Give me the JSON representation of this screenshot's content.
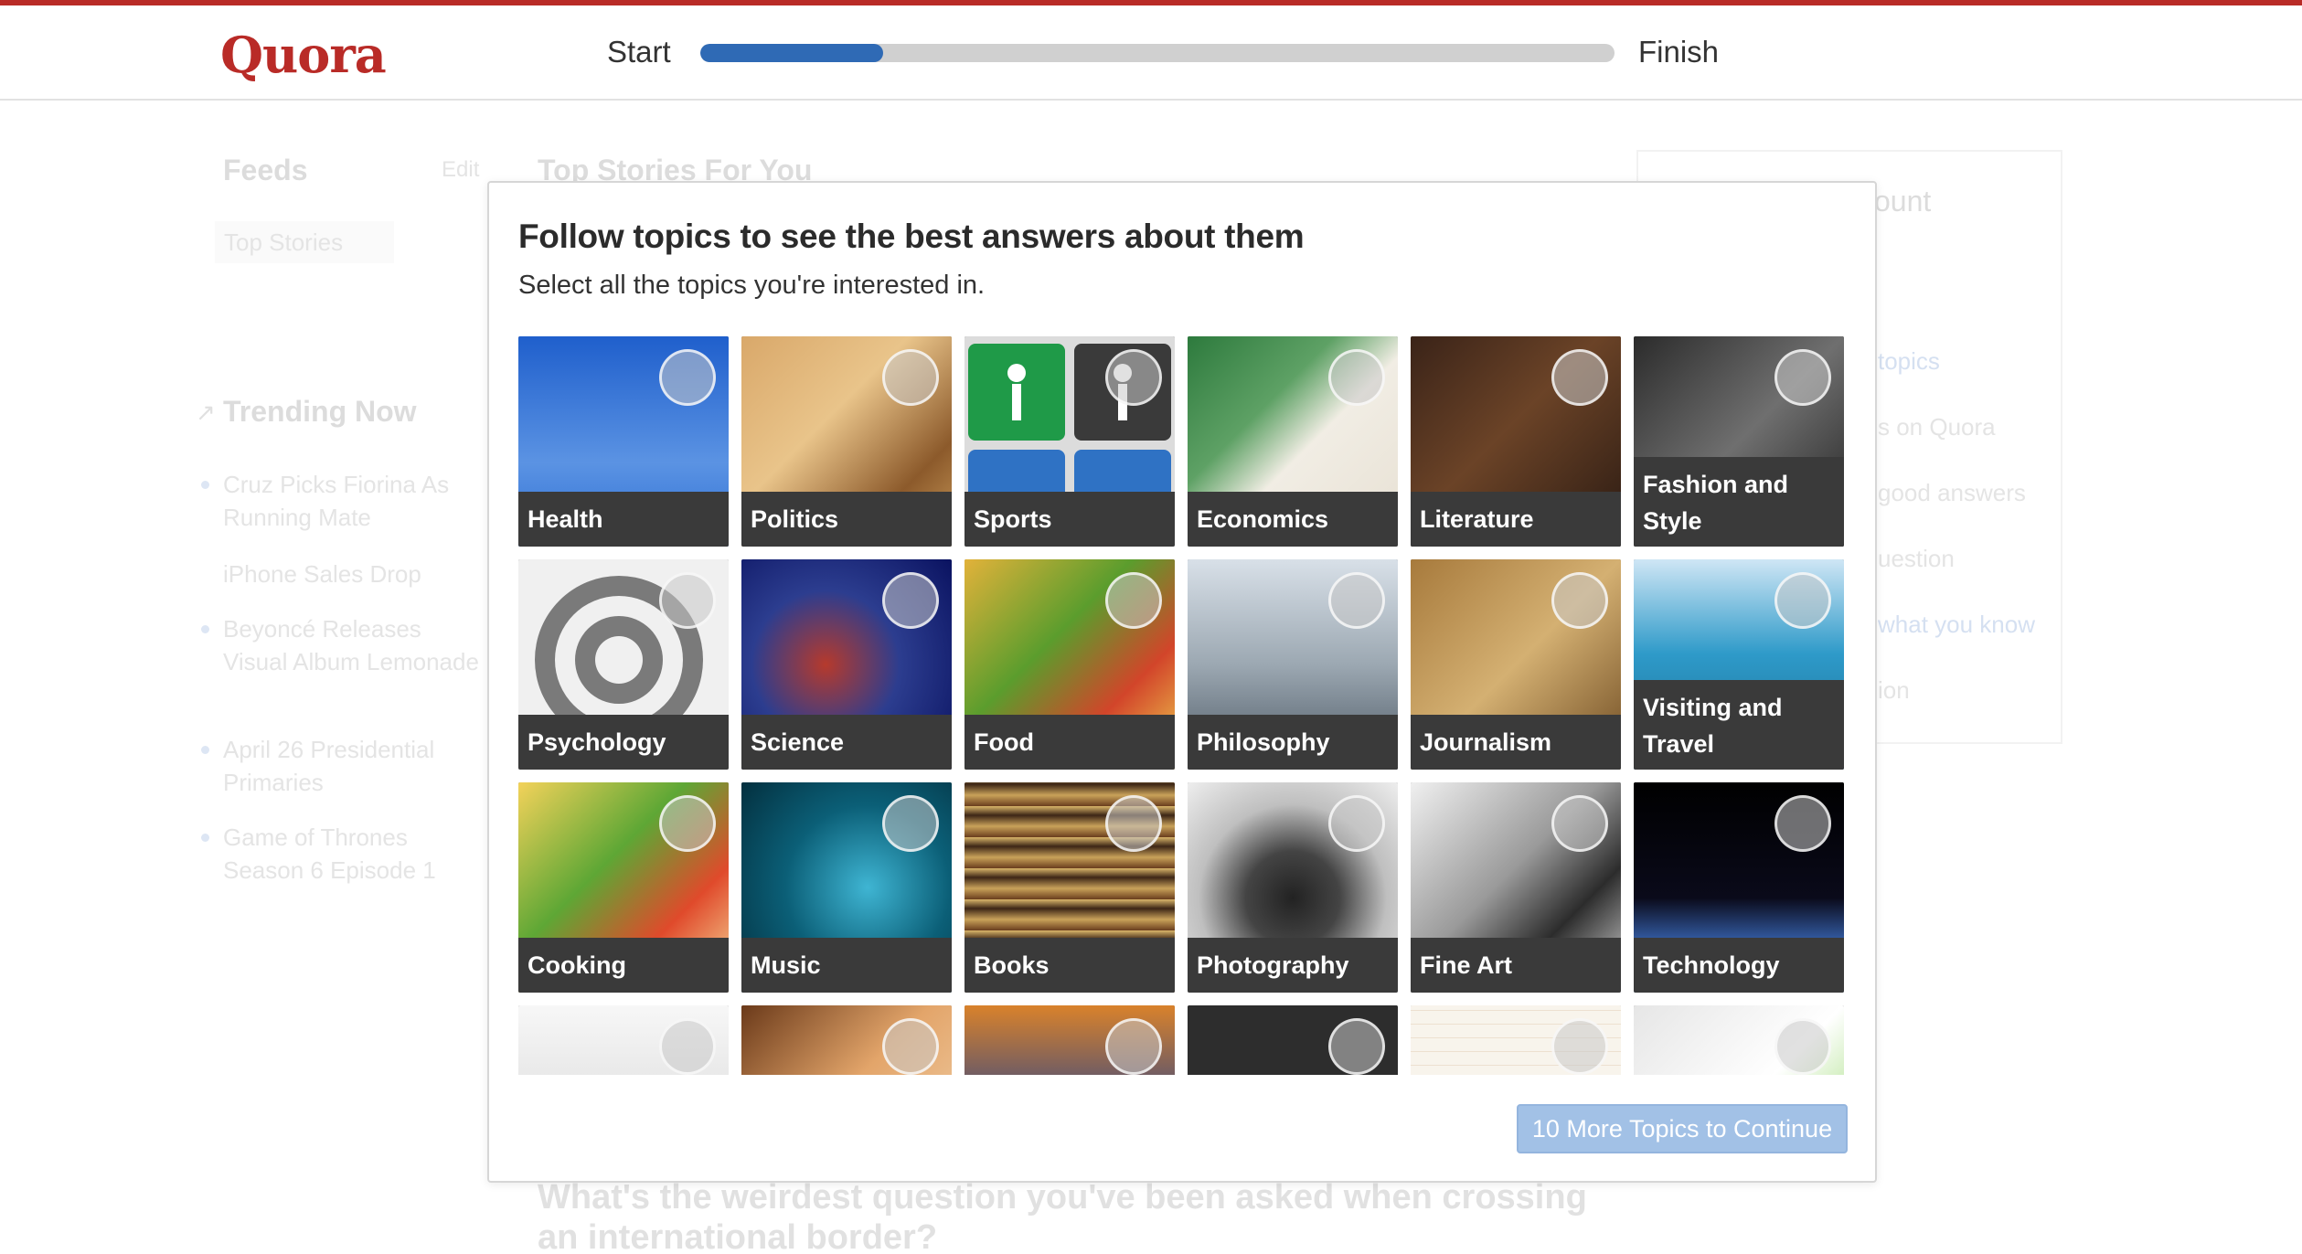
{
  "header": {
    "logo": "Quora",
    "progress": {
      "start_label": "Start",
      "finish_label": "Finish",
      "fraction": 0.2
    }
  },
  "background": {
    "feeds": {
      "title": "Feeds",
      "edit": "Edit",
      "item": "Top Stories"
    },
    "main_title": "Top Stories For You",
    "trending": {
      "title": "Trending Now",
      "items": [
        "Cruz Picks Fiorina As Running Mate",
        "iPhone Sales Drop",
        "Beyoncé Releases Visual Album Lemonade",
        "April 26 Presidential Primaries",
        "Game of Thrones Season 6 Episode 1"
      ]
    },
    "right_panel": {
      "title_fragment": "ount",
      "lines": [
        "topics",
        "s on Quora",
        "good answers",
        "uestion",
        "what you know",
        "ion"
      ]
    },
    "question": "What's the weirdest question you've been asked when crossing an international border?"
  },
  "modal": {
    "title": "Follow topics to see the best answers about them",
    "subtitle": "Select all the topics you're interested in.",
    "topics": [
      {
        "label": "Health"
      },
      {
        "label": "Politics"
      },
      {
        "label": "Sports"
      },
      {
        "label": "Economics"
      },
      {
        "label": "Literature"
      },
      {
        "label": "Fashion and Style"
      },
      {
        "label": "Psychology"
      },
      {
        "label": "Science"
      },
      {
        "label": "Food"
      },
      {
        "label": "Philosophy"
      },
      {
        "label": "Journalism"
      },
      {
        "label": "Visiting and Travel"
      },
      {
        "label": "Cooking"
      },
      {
        "label": "Music"
      },
      {
        "label": "Books"
      },
      {
        "label": "Photography"
      },
      {
        "label": "Fine Art"
      },
      {
        "label": "Technology"
      },
      {
        "label": ""
      },
      {
        "label": ""
      },
      {
        "label": ""
      },
      {
        "label": ""
      },
      {
        "label": ""
      },
      {
        "label": ""
      }
    ],
    "continue_button": "10 More Topics to Continue"
  }
}
